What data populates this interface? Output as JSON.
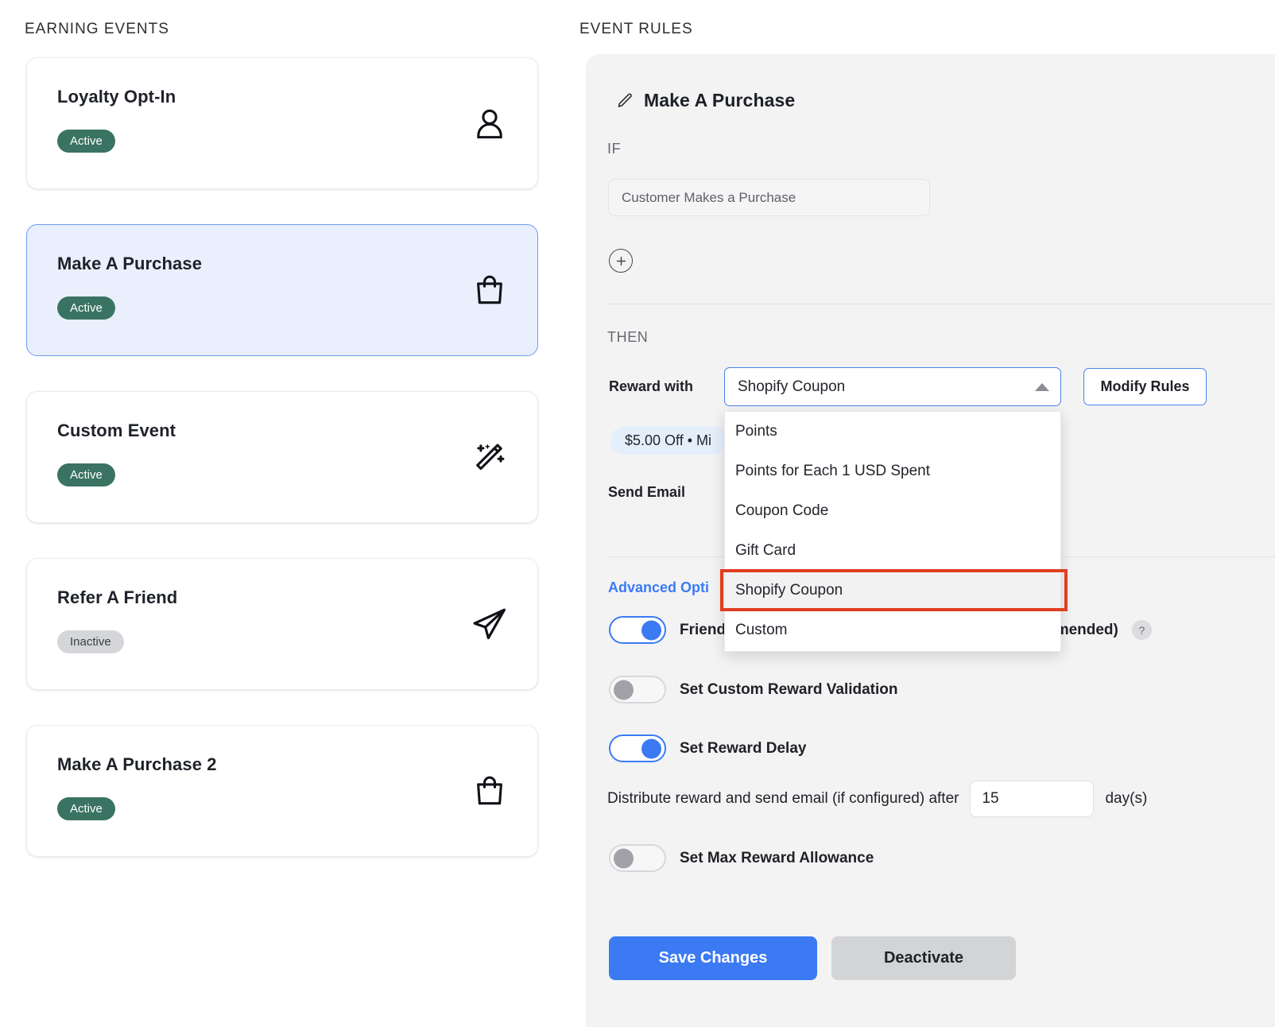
{
  "left_panel": {
    "title": "EARNING EVENTS",
    "events": [
      {
        "name": "Loyalty Opt-In",
        "status": "Active",
        "icon": "user-icon",
        "selected": false
      },
      {
        "name": "Make A Purchase",
        "status": "Active",
        "icon": "shopping-bag-icon",
        "selected": true
      },
      {
        "name": "Custom Event",
        "status": "Active",
        "icon": "magic-wand-icon",
        "selected": false
      },
      {
        "name": "Refer A Friend",
        "status": "Inactive",
        "icon": "paper-plane-icon",
        "selected": false
      },
      {
        "name": "Make A Purchase 2",
        "status": "Active",
        "icon": "shopping-bag-icon",
        "selected": false
      }
    ]
  },
  "right_panel": {
    "title": "EVENT RULES",
    "rule_name": "Make A Purchase",
    "edit_icon": "pencil-icon",
    "if_label": "IF",
    "if_condition": "Customer Makes a Purchase",
    "add_condition_icon": "plus-circle-icon",
    "then_label": "THEN",
    "reward_with_label": "Reward with",
    "reward_with_value": "Shopify Coupon",
    "dropdown_caret_icon": "caret-up-icon",
    "modify_rules_label": "Modify Rules",
    "reward_chip": "$5.00 Off • Mi",
    "send_email_label": "Send Email",
    "advanced_options_label": "Advanced Opti",
    "dropdown_options": [
      "Points",
      "Points for Each 1 USD Spent",
      "Coupon Code",
      "Gift Card",
      "Shopify Coupon",
      "Custom"
    ],
    "dropdown_highlighted": "Shopify Coupon",
    "toggles": [
      {
        "label": "Friend",
        "state": "on",
        "trailing": "ecommended)",
        "help": "?"
      },
      {
        "label": "Set Custom Reward Validation",
        "state": "off"
      },
      {
        "label": "Set Reward Delay",
        "state": "on"
      },
      {
        "label": "Set Max Reward Allowance",
        "state": "off"
      }
    ],
    "delay": {
      "text": "Distribute reward and send email (if configured) after",
      "value": "15",
      "unit": "day(s)"
    },
    "buttons": {
      "save": "Save Changes",
      "deactivate": "Deactivate"
    }
  },
  "colors": {
    "accent_blue": "#3b7af3",
    "active_badge_green": "#3a7362",
    "inactive_badge_gray": "#d5d6d9",
    "selected_card_blue": "#e9effc",
    "panel_gray": "#f3f3f4",
    "highlight_red": "#e03e20"
  }
}
